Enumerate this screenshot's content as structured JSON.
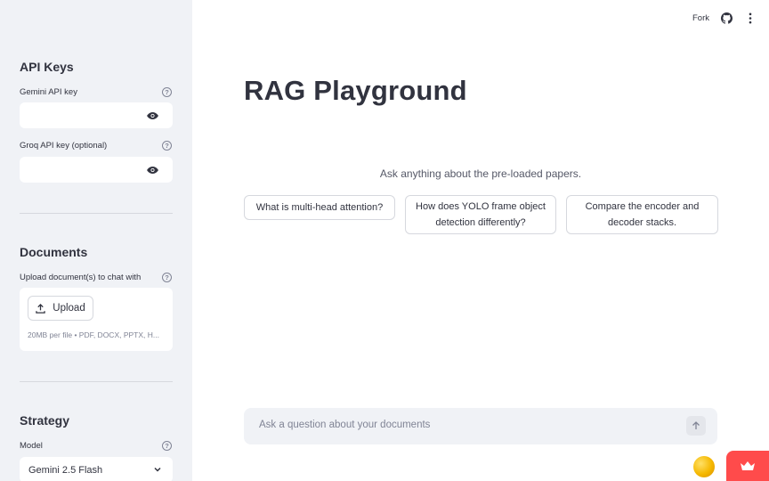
{
  "header": {
    "fork_label": "Fork"
  },
  "sidebar": {
    "api_keys": {
      "title": "API Keys",
      "gemini_label": "Gemini API key",
      "groq_label": "Groq API key (optional)"
    },
    "documents": {
      "title": "Documents",
      "upload_label": "Upload document(s) to chat with",
      "upload_button": "Upload",
      "upload_hint": "20MB per file • PDF, DOCX, PPTX, H..."
    },
    "strategy": {
      "title": "Strategy",
      "model_label": "Model",
      "model_value": "Gemini 2.5 Flash"
    }
  },
  "main": {
    "title": "RAG Playground",
    "subtitle": "Ask anything about the pre-loaded papers.",
    "suggestions": [
      "What is multi-head attention?",
      "How does YOLO frame object detection differently?",
      "Compare the encoder and decoder stacks."
    ],
    "chat_placeholder": "Ask a question about your documents"
  },
  "colors": {
    "accent": "#ff4b4b",
    "sidebar_bg": "#f0f2f6",
    "text": "#31333f"
  },
  "icons": [
    "eye-icon",
    "help-icon",
    "upload-icon",
    "chevron-down-icon",
    "github-icon",
    "more-vertical-icon",
    "arrow-up-icon",
    "crown-icon"
  ]
}
